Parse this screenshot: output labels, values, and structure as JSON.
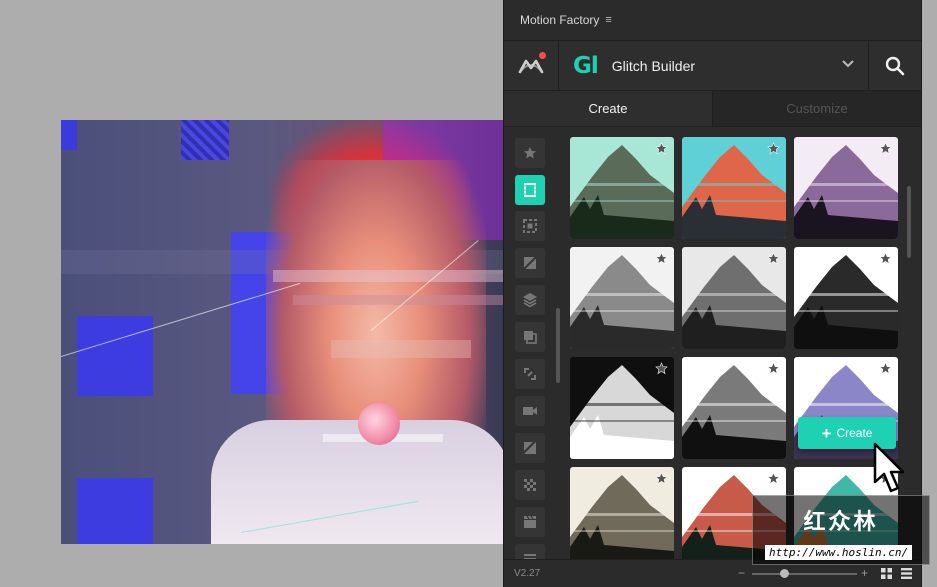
{
  "window": {
    "title": "Motion Factory",
    "menu_glyph": "≡"
  },
  "header": {
    "logo_mark": "Gl",
    "product_name": "Glitch Builder"
  },
  "tabs": [
    {
      "label": "Create",
      "active": true
    },
    {
      "label": "Customize",
      "active": false
    }
  ],
  "sidebar": {
    "items": [
      {
        "icon": "star-icon",
        "active": false
      },
      {
        "icon": "film-icon",
        "active": true
      },
      {
        "icon": "focus-icon",
        "active": false
      },
      {
        "icon": "diagonal-icon",
        "active": false
      },
      {
        "icon": "layers-icon",
        "active": false
      },
      {
        "icon": "duplicate-icon",
        "active": false
      },
      {
        "icon": "transform-icon",
        "active": false
      },
      {
        "icon": "video-icon",
        "active": false
      },
      {
        "icon": "slash-icon",
        "active": false
      },
      {
        "icon": "checker-icon",
        "active": false
      },
      {
        "icon": "clapper-icon",
        "active": false
      },
      {
        "icon": "list-icon",
        "active": false
      }
    ]
  },
  "presets": [
    {
      "style": "teal",
      "favorite": false
    },
    {
      "style": "red-scan",
      "favorite": false
    },
    {
      "style": "purple-sunset",
      "favorite": false
    },
    {
      "style": "gray-smear",
      "favorite": false
    },
    {
      "style": "gray-mono",
      "favorite": false
    },
    {
      "style": "bw-glitch",
      "favorite": false
    },
    {
      "style": "dark-invert",
      "favorite": false
    },
    {
      "style": "bw-sunset",
      "favorite": false
    },
    {
      "style": "purple-haze",
      "favorite": false
    },
    {
      "style": "sepia-scan",
      "favorite": false
    },
    {
      "style": "color-forest",
      "favorite": false
    },
    {
      "style": "teal-sunset",
      "favorite": false
    }
  ],
  "create_button": {
    "label": "Create"
  },
  "footer": {
    "version": "V2.27",
    "minus": "−",
    "plus": "+"
  },
  "watermark": {
    "title": "红众林",
    "url": "http://www.hoslin.cn/"
  },
  "colors": {
    "accent": "#1fd1b3",
    "panel": "#2b2b2b",
    "notification": "#ff4a4a"
  }
}
